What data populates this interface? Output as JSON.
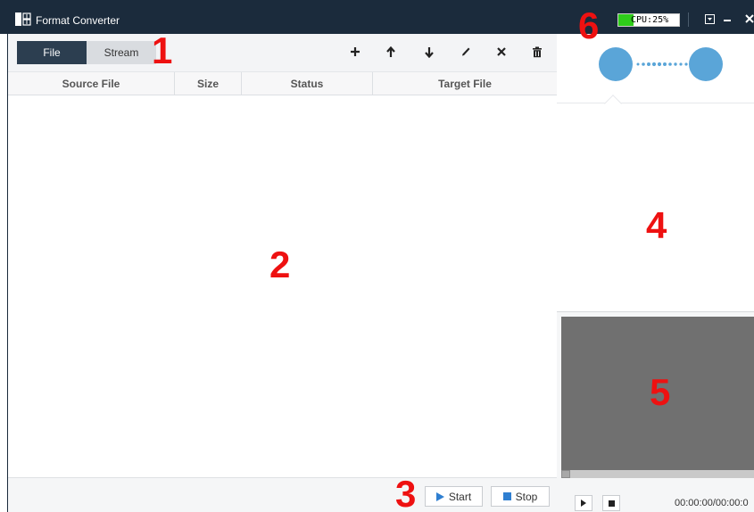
{
  "window": {
    "title": "Format Converter",
    "cpu_label": "CPU:25%",
    "cpu_usage_fraction": 0.25
  },
  "titlebar_icons": [
    "app-icon",
    "menu-dropdown-icon",
    "minimize-icon",
    "close-icon"
  ],
  "tabs": [
    {
      "label": "File",
      "active": true
    },
    {
      "label": "Stream",
      "active": false
    }
  ],
  "toolbar_icons": [
    "add-icon",
    "move-up-icon",
    "move-down-icon",
    "edit-icon",
    "remove-icon",
    "trash-icon"
  ],
  "table": {
    "columns": [
      "Source File",
      "Size",
      "Status",
      "Target File"
    ],
    "rows": []
  },
  "footer": {
    "start_label": "Start",
    "stop_label": "Stop"
  },
  "player": {
    "time": "00:00:00/00:00:0",
    "controls": [
      "play-icon",
      "stop-icon"
    ]
  },
  "markers": {
    "m1": "1",
    "m2": "2",
    "m3": "3",
    "m4": "4",
    "m5": "5",
    "m6": "6"
  },
  "colors": {
    "titlebar": "#1b2b3c",
    "accent": "#5aa5d8",
    "active_tab": "#2c3e50",
    "cpu_fill": "#2ecc1a",
    "marker": "#ee1111"
  }
}
